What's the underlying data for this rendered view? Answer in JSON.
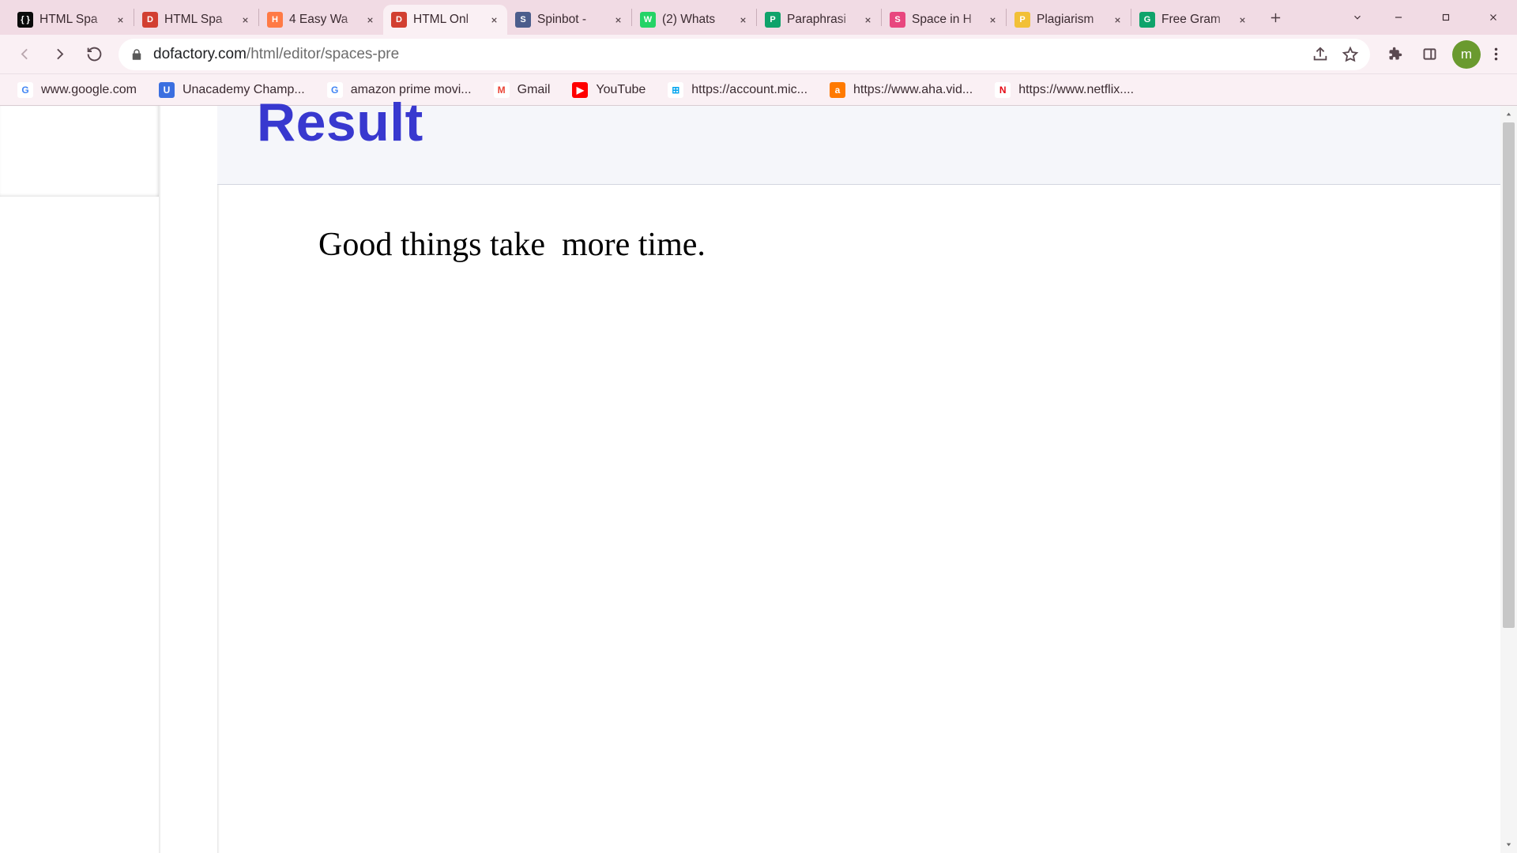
{
  "tabs": [
    {
      "label": "HTML Spa",
      "favicon_bg": "#0b0b0b",
      "favicon_txt": "{ }"
    },
    {
      "label": "HTML Spa",
      "favicon_bg": "#d23f31",
      "favicon_txt": "D"
    },
    {
      "label": "4 Easy Wa",
      "favicon_bg": "#ff7a45",
      "favicon_txt": "H"
    },
    {
      "label": "HTML Onl",
      "favicon_bg": "#d23f31",
      "favicon_txt": "D",
      "active": true
    },
    {
      "label": "Spinbot -",
      "favicon_bg": "#4b5d8c",
      "favicon_txt": "S"
    },
    {
      "label": "(2) Whats",
      "favicon_bg": "#25d366",
      "favicon_txt": "W"
    },
    {
      "label": "Paraphrasi",
      "favicon_bg": "#0fa36b",
      "favicon_txt": "P"
    },
    {
      "label": "Space in H",
      "favicon_bg": "#e8467e",
      "favicon_txt": "S"
    },
    {
      "label": "Plagiarism",
      "favicon_bg": "#f2c037",
      "favicon_txt": "P"
    },
    {
      "label": "Free Gram",
      "favicon_bg": "#0fa36b",
      "favicon_txt": "G"
    }
  ],
  "url": {
    "domain": "dofactory.com",
    "path": "/html/editor/spaces-pre"
  },
  "bookmarks": [
    {
      "label": "www.google.com",
      "icon_bg": "#fff",
      "icon_txt": "G",
      "txt_color": "#4285f4"
    },
    {
      "label": "Unacademy Champ...",
      "icon_bg": "#3b6fe0",
      "icon_txt": "U"
    },
    {
      "label": "amazon prime movi...",
      "icon_bg": "#fff",
      "icon_txt": "G",
      "txt_color": "#4285f4"
    },
    {
      "label": "Gmail",
      "icon_bg": "#fff",
      "icon_txt": "M",
      "txt_color": "#ea4335"
    },
    {
      "label": "YouTube",
      "icon_bg": "#ff0000",
      "icon_txt": "▶"
    },
    {
      "label": "https://account.mic...",
      "icon_bg": "#fff",
      "icon_txt": "⊞",
      "txt_color": "#00a4ef"
    },
    {
      "label": "https://www.aha.vid...",
      "icon_bg": "#ff7a00",
      "icon_txt": "a"
    },
    {
      "label": "https://www.netflix....",
      "icon_bg": "#fff",
      "icon_txt": "N",
      "txt_color": "#e50914"
    }
  ],
  "avatar_initial": "m",
  "page": {
    "heading": "Result",
    "body_text": "Good things take  more time."
  }
}
